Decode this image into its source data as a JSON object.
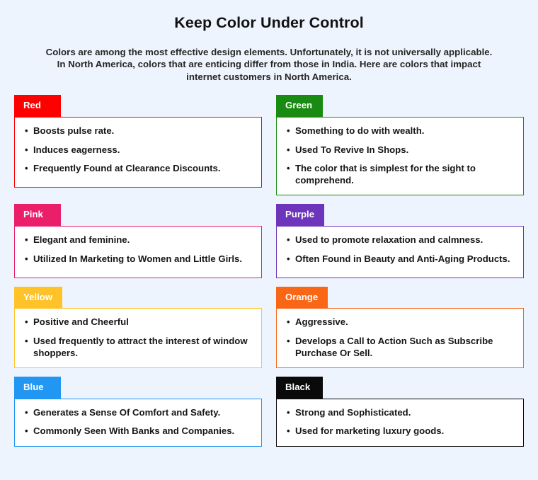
{
  "header": {
    "title": "Keep Color Under Control",
    "subtitle": "Colors are among the most effective design elements. Unfortunately, it is not universally applicable. In North America, colors that are enticing differ from those in India. Here are colors that impact internet customers in North America."
  },
  "palette": {
    "page_background": "#eef4fd",
    "card_background": "#ffffff",
    "text": "#161616"
  },
  "cards": [
    {
      "name": "Red",
      "color": "#ff0000",
      "border": "#ff0000",
      "label_color": "#ffffff",
      "bullets": [
        "Boosts pulse rate.",
        "Induces eagerness.",
        "Frequently Found at Clearance Discounts."
      ]
    },
    {
      "name": "Green",
      "color": "#1a8b12",
      "border": "#1a8b12",
      "label_color": "#ffffff",
      "bullets": [
        "Something to do with wealth.",
        "Used To Revive In Shops.",
        "The color that is simplest for the sight to comprehend."
      ]
    },
    {
      "name": "Pink",
      "color": "#ea1e69",
      "border": "#ea1e69",
      "label_color": "#ffffff",
      "bullets": [
        "Elegant and feminine.",
        "Utilized In Marketing to Women and Little Girls."
      ]
    },
    {
      "name": "Purple",
      "color": "#6d35bb",
      "border": "#6d35bb",
      "label_color": "#ffffff",
      "bullets": [
        "Used to promote relaxation and calmness.",
        "Often Found in Beauty and Anti-Aging Products."
      ]
    },
    {
      "name": "Yellow",
      "color": "#ffc229",
      "border": "#ffc229",
      "label_color": "#ffffff",
      "bullets": [
        "Positive and Cheerful",
        "Used frequently to attract the interest of window shoppers."
      ]
    },
    {
      "name": "Orange",
      "color": "#f96616",
      "border": "#f96616",
      "label_color": "#ffffff",
      "bullets": [
        "Aggressive.",
        "Develops a Call to Action Such as Subscribe Purchase Or Sell."
      ]
    },
    {
      "name": "Blue",
      "color": "#2196f3",
      "border": "#2196f3",
      "label_color": "#ffffff",
      "bullets": [
        "Generates a Sense Of Comfort and Safety.",
        "Commonly Seen With Banks and Companies."
      ]
    },
    {
      "name": "Black",
      "color": "#0a0a0a",
      "border": "#0a0a0a",
      "label_color": "#ffffff",
      "bullets": [
        "Strong and Sophisticated.",
        "Used for marketing luxury goods."
      ]
    }
  ]
}
